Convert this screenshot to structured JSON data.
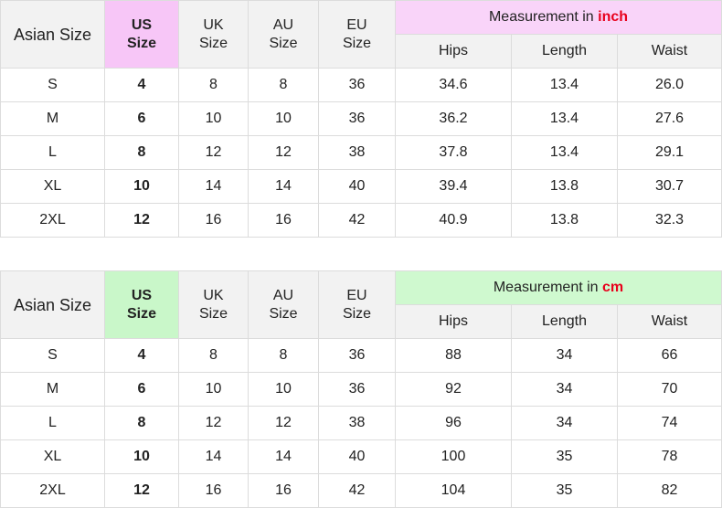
{
  "inch_table": {
    "headers": {
      "asian_size": "Asian Size",
      "us_line1": "US",
      "us_line2": "Size",
      "uk_line1": "UK",
      "uk_line2": "Size",
      "au_line1": "AU",
      "au_line2": "Size",
      "eu_line1": "EU",
      "eu_line2": "Size",
      "measurement_prefix": "Measurement in ",
      "measurement_unit": "inch",
      "hips": "Hips",
      "length": "Length",
      "waist": "Waist"
    },
    "rows": [
      {
        "asian": "S",
        "us": "4",
        "uk": "8",
        "au": "8",
        "eu": "36",
        "hips": "34.6",
        "length": "13.4",
        "waist": "26.0"
      },
      {
        "asian": "M",
        "us": "6",
        "uk": "10",
        "au": "10",
        "eu": "36",
        "hips": "36.2",
        "length": "13.4",
        "waist": "27.6"
      },
      {
        "asian": "L",
        "us": "8",
        "uk": "12",
        "au": "12",
        "eu": "38",
        "hips": "37.8",
        "length": "13.4",
        "waist": "29.1"
      },
      {
        "asian": "XL",
        "us": "10",
        "uk": "14",
        "au": "14",
        "eu": "40",
        "hips": "39.4",
        "length": "13.8",
        "waist": "30.7"
      },
      {
        "asian": "2XL",
        "us": "12",
        "uk": "16",
        "au": "16",
        "eu": "42",
        "hips": "40.9",
        "length": "13.8",
        "waist": "32.3"
      }
    ]
  },
  "cm_table": {
    "headers": {
      "asian_size": "Asian Size",
      "us_line1": "US",
      "us_line2": "Size",
      "uk_line1": "UK",
      "uk_line2": "Size",
      "au_line1": "AU",
      "au_line2": "Size",
      "eu_line1": "EU",
      "eu_line2": "Size",
      "measurement_prefix": "Measurement in ",
      "measurement_unit": "cm",
      "hips": "Hips",
      "length": "Length",
      "waist": "Waist"
    },
    "rows": [
      {
        "asian": "S",
        "us": "4",
        "uk": "8",
        "au": "8",
        "eu": "36",
        "hips": "88",
        "length": "34",
        "waist": "66"
      },
      {
        "asian": "M",
        "us": "6",
        "uk": "10",
        "au": "10",
        "eu": "36",
        "hips": "92",
        "length": "34",
        "waist": "70"
      },
      {
        "asian": "L",
        "us": "8",
        "uk": "12",
        "au": "12",
        "eu": "38",
        "hips": "96",
        "length": "34",
        "waist": "74"
      },
      {
        "asian": "XL",
        "us": "10",
        "uk": "14",
        "au": "14",
        "eu": "40",
        "hips": "100",
        "length": "35",
        "waist": "78"
      },
      {
        "asian": "2XL",
        "us": "12",
        "uk": "16",
        "au": "16",
        "eu": "42",
        "hips": "104",
        "length": "35",
        "waist": "82"
      }
    ]
  },
  "colors": {
    "inch_us_header": "#f7c6f7",
    "inch_measure_header": "#f9d4f9",
    "cm_us_header": "#c9f7c9",
    "cm_measure_header": "#cff9cf",
    "unit_text": "#e8001c",
    "header_gray": "#f2f2f2"
  }
}
